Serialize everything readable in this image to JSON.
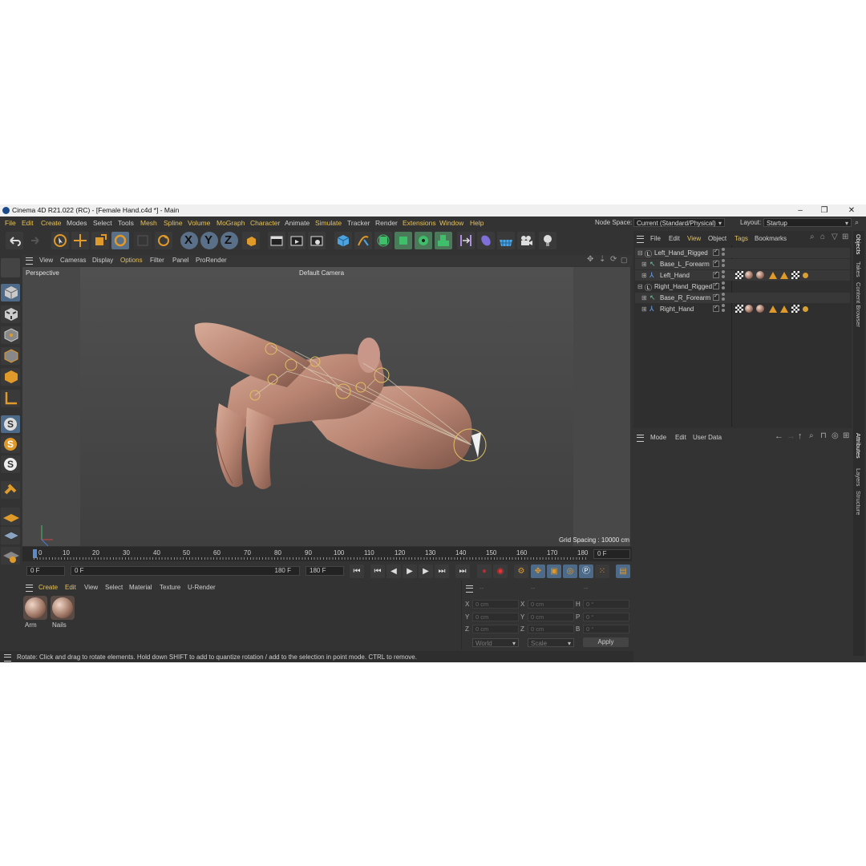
{
  "window": {
    "title": "Cinema 4D R21.022 (RC) - [Female Hand.c4d *] - Main",
    "minimize": "–",
    "restore": "❐",
    "close": "✕"
  },
  "menu": {
    "items": [
      "File",
      "Edit",
      "Create",
      "Modes",
      "Select",
      "Tools",
      "Mesh",
      "Spline",
      "Volume",
      "MoGraph",
      "Character",
      "Animate",
      "Simulate",
      "Tracker",
      "Render",
      "Extensions",
      "Window",
      "Help"
    ],
    "node_space_label": "Node Space:",
    "node_space_value": "Current (Standard/Physical)",
    "layout_label": "Layout:",
    "layout_value": "Startup"
  },
  "toolbar": {
    "axis_x": "X",
    "axis_y": "Y",
    "axis_z": "Z"
  },
  "viewport": {
    "menu": [
      "View",
      "Cameras",
      "Display",
      "Options",
      "Filter",
      "Panel",
      "ProRender"
    ],
    "label": "Perspective",
    "camera": "Default Camera",
    "grid_spacing": "Grid Spacing : 10000 cm"
  },
  "timeline": {
    "ticks": [
      "0",
      "10",
      "20",
      "30",
      "40",
      "50",
      "60",
      "70",
      "80",
      "90",
      "100",
      "110",
      "120",
      "130",
      "140",
      "150",
      "160",
      "170",
      "180"
    ],
    "current_frame": "0 F",
    "start_field": "0 F",
    "range_start": "0 F",
    "range_end": "180 F",
    "end_field": "180 F"
  },
  "materials": {
    "menu": [
      "Create",
      "Edit",
      "View",
      "Select",
      "Material",
      "Texture",
      "U-Render"
    ],
    "items": [
      {
        "label": "Arm"
      },
      {
        "label": "Nails"
      }
    ]
  },
  "coords": {
    "header": [
      "--",
      "--",
      "--"
    ],
    "rows": [
      {
        "a": "X",
        "av": "0 cm",
        "b": "X",
        "bv": "0 cm",
        "c": "H",
        "cv": "0 °"
      },
      {
        "a": "Y",
        "av": "0 cm",
        "b": "Y",
        "bv": "0 cm",
        "c": "P",
        "cv": "0 °"
      },
      {
        "a": "Z",
        "av": "0 cm",
        "b": "Z",
        "bv": "0 cm",
        "c": "B",
        "cv": "0 °"
      }
    ],
    "space": "World",
    "mode": "Scale",
    "apply": "Apply"
  },
  "objects": {
    "menu": [
      "File",
      "Edit",
      "View",
      "Object",
      "Tags",
      "Bookmarks"
    ],
    "rows": [
      {
        "name": "Left_Hand_Rigged",
        "icon": "null-icon"
      },
      {
        "name": "Base_L_Forearm",
        "icon": "joint-icon"
      },
      {
        "name": "Left_Hand",
        "icon": "skin-icon"
      },
      {
        "name": "Right_Hand_Rigged",
        "icon": "null-icon"
      },
      {
        "name": "Base_R_Forearm",
        "icon": "joint-icon"
      },
      {
        "name": "Right_Hand",
        "icon": "skin-icon"
      }
    ]
  },
  "attributes": {
    "menu": [
      "Mode",
      "Edit",
      "User Data"
    ]
  },
  "side_tabs": {
    "right_top": [
      "Objects",
      "Takes",
      "Content Browser"
    ],
    "right_bottom": [
      "Attributes",
      "Layers",
      "Structure"
    ]
  },
  "status": "Rotate: Click and drag to rotate elements. Hold down SHIFT to add to quantize rotation / add to the selection in point mode. CTRL to remove.",
  "colors": {
    "background": "#333333",
    "accent_highlight": "#e6c25a",
    "active_tool": "#5a6f88"
  }
}
